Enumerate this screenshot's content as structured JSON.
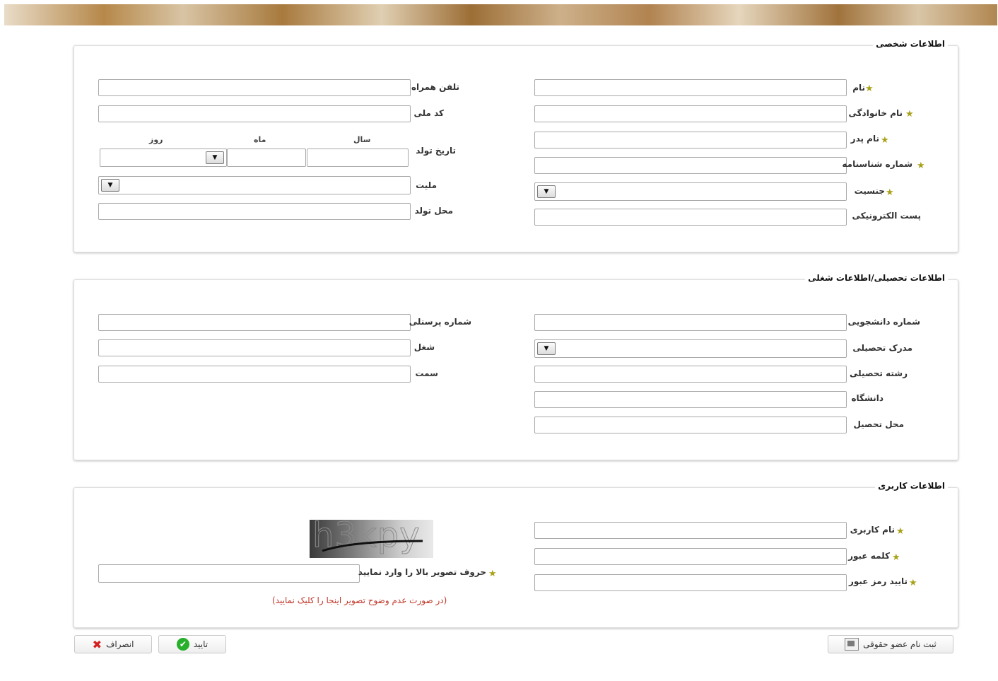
{
  "personal": {
    "title": "اطلاعات شخصی",
    "name": "نام",
    "family": "نام خانوادگی",
    "father": "نام پدر",
    "id_number": "شماره شناسنامه",
    "gender": "جنسیت",
    "email": "پست الکترونیکی",
    "mobile": "تلفن همراه",
    "national_code": "کد ملی",
    "birth_date": "تاریخ تولد",
    "year": "سال",
    "month": "ماه",
    "day": "روز",
    "nationality": "ملیت",
    "birth_place": "محل تولد"
  },
  "education": {
    "title": "اطلاعات تحصیلی/اطلاعات شغلی",
    "student_no": "شماره دانشجویی",
    "degree": "مدرک تحصیلی",
    "field": "رشته تحصیلی",
    "university": "دانشگاه",
    "study_place": "محل تحصیل",
    "personnel_no": "شماره پرسنلی",
    "job": "شغل",
    "position": "سمت"
  },
  "user": {
    "title": "اطلاعات کاربری",
    "username": "نام کاربری",
    "password": "کلمه عبور",
    "confirm_password": "تایید رمز عبور",
    "captcha_text": "h3kpy",
    "captcha_label": "حروف تصویر بالا را وارد نمایید",
    "captcha_hint": "(در صورت عدم وضوح تصویر اینجا را کلیک نمایید)"
  },
  "buttons": {
    "cancel": "انصراف",
    "confirm": "تایید",
    "legal_register": "ثبت نام عضو حقوقی"
  },
  "icons": {
    "required": "★",
    "dropdown": "▼",
    "check": "✔",
    "cancel_x": "✖"
  },
  "colors": {
    "required_star": "#a8a21a",
    "hint_red": "#c0392b",
    "check_green": "#27b02c",
    "cancel_red": "#d42020"
  }
}
